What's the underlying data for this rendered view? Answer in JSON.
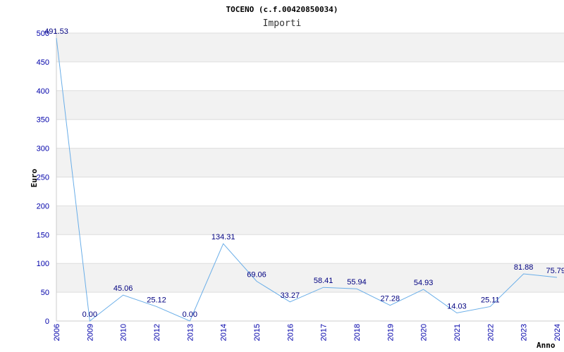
{
  "chart_data": {
    "type": "line",
    "title": "TOCENO (c.f.00420850034)",
    "subtitle": "Importi",
    "xlabel": "Anno",
    "ylabel": "Euro",
    "categories": [
      "2006",
      "2009",
      "2010",
      "2012",
      "2013",
      "2014",
      "2015",
      "2016",
      "2017",
      "2018",
      "2019",
      "2020",
      "2021",
      "2022",
      "2023",
      "2024"
    ],
    "values": [
      491.53,
      0.0,
      45.06,
      25.12,
      0.0,
      134.31,
      69.06,
      33.27,
      58.41,
      55.94,
      27.28,
      54.93,
      14.03,
      25.11,
      81.88,
      75.79
    ],
    "data_labels": [
      "491.53",
      "0.00",
      "45.06",
      "25.12",
      "0.00",
      "134.31",
      "69.06",
      "33.27",
      "58.41",
      "55.94",
      "27.28",
      "54.93",
      "14.03",
      "25.11",
      "81.88",
      "75.79"
    ],
    "ylim": [
      0,
      500
    ],
    "yticks": [
      0,
      50,
      100,
      150,
      200,
      250,
      300,
      350,
      400,
      450,
      500
    ],
    "grid": true,
    "colors": {
      "line": "#6aaee8",
      "band": "#f2f2f2",
      "grid": "#dddddd",
      "tick_text": "#0000aa",
      "data_label": "#000080"
    }
  }
}
